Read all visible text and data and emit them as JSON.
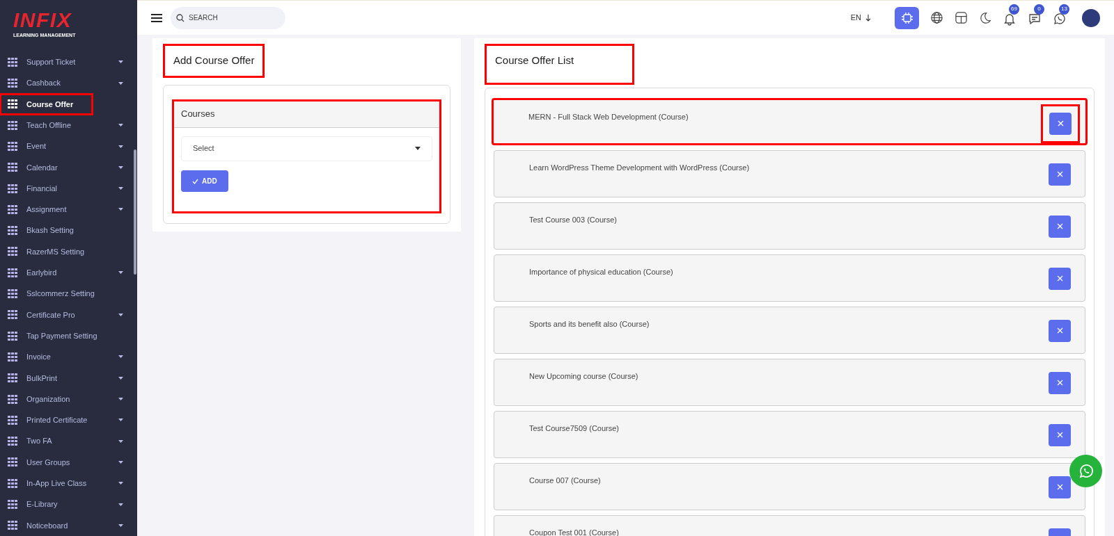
{
  "brand": {
    "logo": "INFIX",
    "tagline": "LEARNING MANAGEMENT"
  },
  "sidebar": {
    "items": [
      {
        "label": "Support Ticket",
        "selected": false,
        "expandable": true
      },
      {
        "label": "Cashback",
        "selected": false,
        "expandable": true
      },
      {
        "label": "Course Offer",
        "selected": true,
        "expandable": false,
        "highlighted": true
      },
      {
        "label": "Teach Offline",
        "selected": false,
        "expandable": true
      },
      {
        "label": "Event",
        "selected": false,
        "expandable": true
      },
      {
        "label": "Calendar",
        "selected": false,
        "expandable": true
      },
      {
        "label": "Financial",
        "selected": false,
        "expandable": true
      },
      {
        "label": "Assignment",
        "selected": false,
        "expandable": true
      },
      {
        "label": "Bkash Setting",
        "selected": false,
        "expandable": false
      },
      {
        "label": "RazerMS Setting",
        "selected": false,
        "expandable": false
      },
      {
        "label": "Earlybird",
        "selected": false,
        "expandable": true
      },
      {
        "label": "Sslcommerz Setting",
        "selected": false,
        "expandable": false
      },
      {
        "label": "Certificate Pro",
        "selected": false,
        "expandable": true
      },
      {
        "label": "Tap Payment Setting",
        "selected": false,
        "expandable": false
      },
      {
        "label": "Invoice",
        "selected": false,
        "expandable": true
      },
      {
        "label": "BulkPrint",
        "selected": false,
        "expandable": true
      },
      {
        "label": "Organization",
        "selected": false,
        "expandable": true
      },
      {
        "label": "Printed Certificate",
        "selected": false,
        "expandable": true
      },
      {
        "label": "Two FA",
        "selected": false,
        "expandable": true
      },
      {
        "label": "User Groups",
        "selected": false,
        "expandable": true
      },
      {
        "label": "In-App Live Class",
        "selected": false,
        "expandable": true
      },
      {
        "label": "E-Library",
        "selected": false,
        "expandable": true
      },
      {
        "label": "Noticeboard",
        "selected": false,
        "expandable": true
      }
    ]
  },
  "topbar": {
    "search": {
      "placeholder": "SEARCH"
    },
    "language": "EN",
    "badges": [
      {
        "kind": "bell",
        "count": "69"
      },
      {
        "kind": "chat",
        "count": "0"
      },
      {
        "kind": "whatsapp",
        "count": "13"
      }
    ]
  },
  "add_form": {
    "title": "Add Course Offer",
    "title_highlighted": true,
    "panel_title": "Courses",
    "panel_highlighted": true,
    "select": {
      "value": "Select"
    },
    "button": "ADD"
  },
  "offer_list": {
    "title": "Course Offer List",
    "title_highlighted": true,
    "rows": [
      {
        "name": "MERN - Full Stack Web Development (Course)",
        "highlighted": true
      },
      {
        "name": "Learn WordPress Theme Development with WordPress (Course)",
        "highlighted": false
      },
      {
        "name": "Test Course 003 (Course)",
        "highlighted": false
      },
      {
        "name": "Importance of physical education (Course)",
        "highlighted": false
      },
      {
        "name": "Sports and its benefit also (Course)",
        "highlighted": false
      },
      {
        "name": "New Upcoming course (Course)",
        "highlighted": false
      },
      {
        "name": "Test Course7509 (Course)",
        "highlighted": false
      },
      {
        "name": "Course 007 (Course)",
        "highlighted": false
      },
      {
        "name": "Coupon Test 001 (Course)",
        "highlighted": false
      }
    ]
  }
}
